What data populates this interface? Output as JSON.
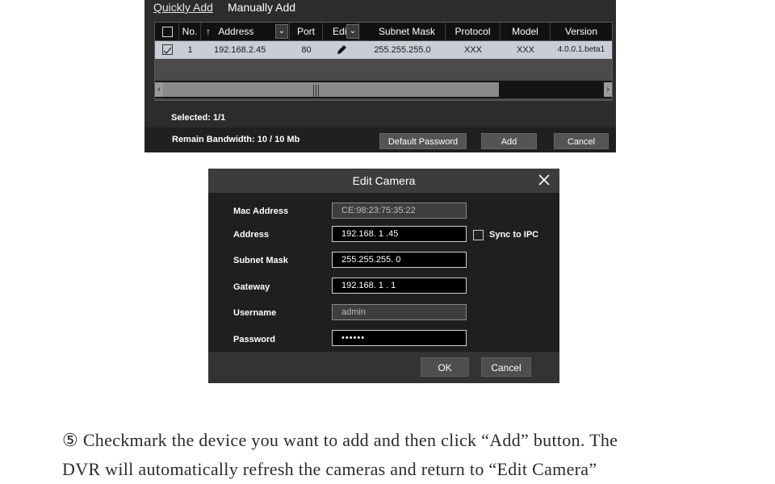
{
  "add_panel": {
    "tabs": [
      "Quickly Add",
      "Manually Add"
    ],
    "columns": {
      "no": "No.",
      "address": "Address",
      "address_sort_arrow": "↑",
      "port": "Port",
      "edit": "Edit",
      "subnet_mask": "Subnet Mask",
      "protocol": "Protocol",
      "model": "Model",
      "version": "Version"
    },
    "rows": [
      {
        "checked": true,
        "no": "1",
        "address": "192.168.2.45",
        "port": "80",
        "edit_icon": "pencil-icon",
        "subnet_mask": "255.255.255.0",
        "protocol": "XXX",
        "model": "XXX",
        "version": "4.0.0.1.beta1"
      }
    ],
    "selected": "Selected: 1/1",
    "bandwidth": "Remain Bandwidth: 10 / 10 Mb",
    "buttons": {
      "default_password": "Default Password",
      "add": "Add",
      "cancel": "Cancel"
    }
  },
  "edit_dialog": {
    "title": "Edit  Camera",
    "labels": {
      "mac": "Mac Address",
      "address": "Address",
      "subnet_mask": "Subnet Mask",
      "gateway": "Gateway",
      "username": "Username",
      "password": "Password"
    },
    "values": {
      "mac": "CE:98:23:75:35:22",
      "address": "192.168.  1  .45",
      "subnet_mask": "255.255.255.  0",
      "gateway": "192.168.  1  .  1",
      "username": "admin",
      "password": "••••••"
    },
    "sync_label": "Sync to IPC",
    "buttons": {
      "ok": "OK",
      "cancel": "Cancel"
    }
  },
  "instruction": {
    "line1": "⑤ Checkmark the device you want to add and then click “Add” button. The",
    "line2": "DVR will automatically refresh the cameras and return to “Edit Camera”"
  }
}
